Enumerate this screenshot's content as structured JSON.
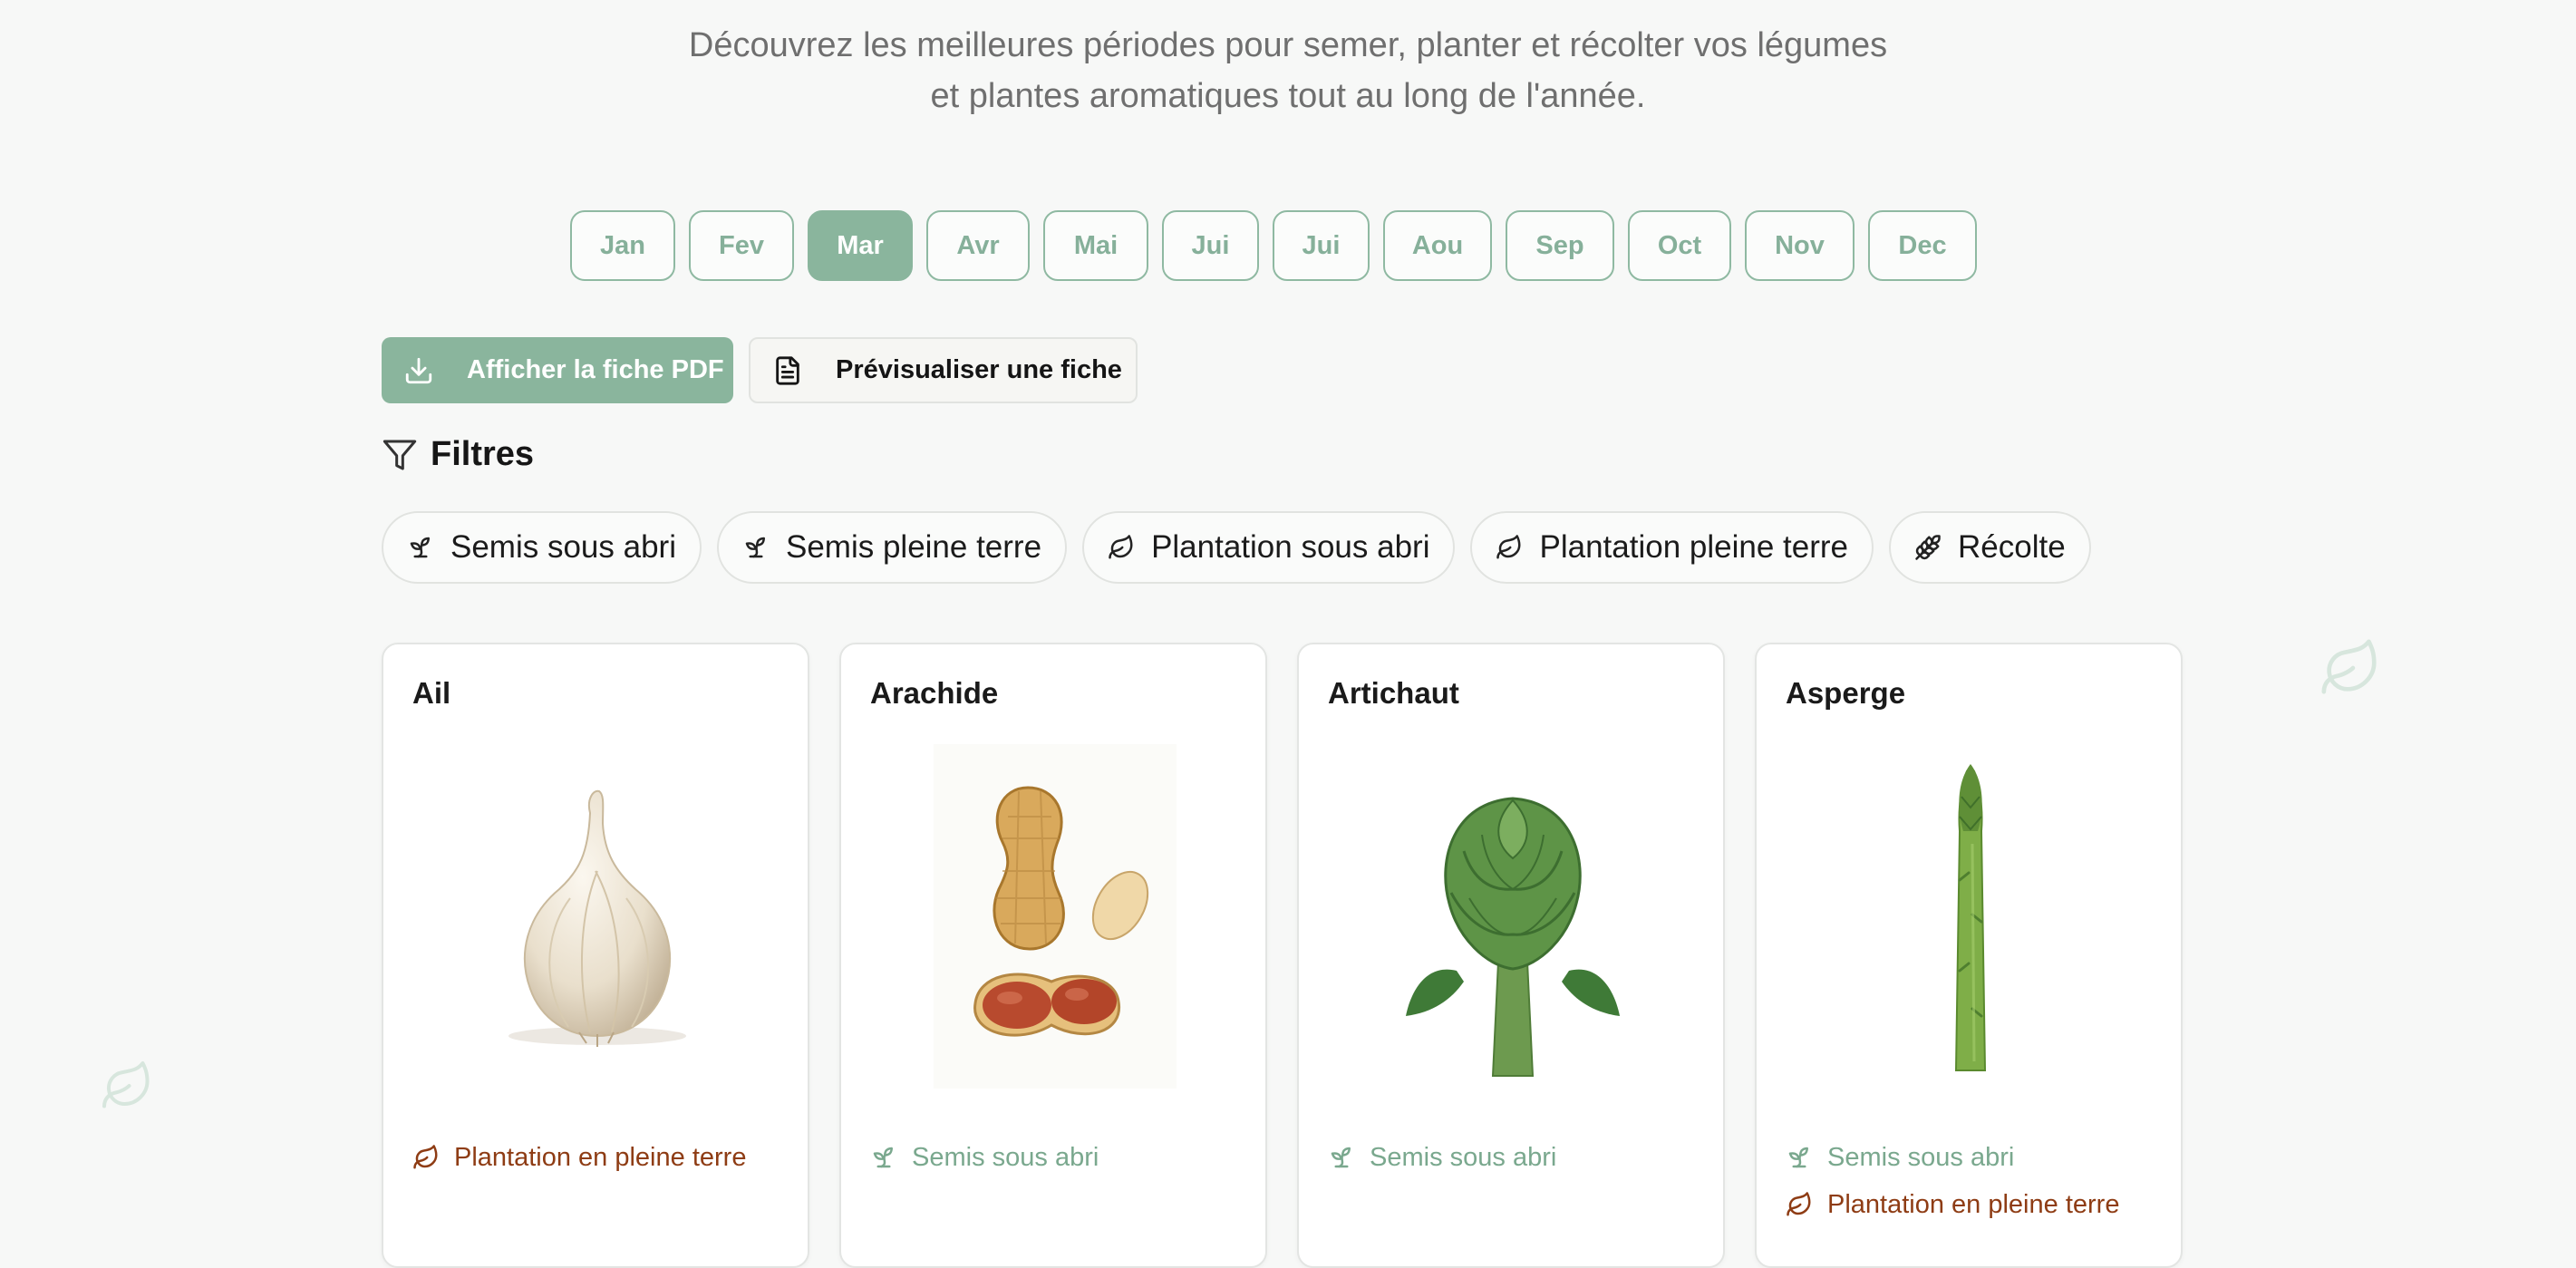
{
  "intro": {
    "line1": "Découvrez les meilleures périodes pour semer, planter et récolter vos légumes",
    "line2": "et plantes aromatiques tout au long de l'année."
  },
  "months": [
    {
      "label": "Jan",
      "active": false
    },
    {
      "label": "Fev",
      "active": false
    },
    {
      "label": "Mar",
      "active": true
    },
    {
      "label": "Avr",
      "active": false
    },
    {
      "label": "Mai",
      "active": false
    },
    {
      "label": "Jui",
      "active": false
    },
    {
      "label": "Jui",
      "active": false
    },
    {
      "label": "Aou",
      "active": false
    },
    {
      "label": "Sep",
      "active": false
    },
    {
      "label": "Oct",
      "active": false
    },
    {
      "label": "Nov",
      "active": false
    },
    {
      "label": "Dec",
      "active": false
    }
  ],
  "actions": {
    "pdf_label": "Afficher la fiche PDF",
    "preview_label": "Prévisualiser une fiche"
  },
  "filters": {
    "title": "Filtres",
    "chips": [
      {
        "label": "Semis sous abri",
        "icon": "sprout-icon"
      },
      {
        "label": "Semis pleine terre",
        "icon": "sprout-icon"
      },
      {
        "label": "Plantation sous abri",
        "icon": "leaf-icon"
      },
      {
        "label": "Plantation pleine terre",
        "icon": "leaf-icon"
      },
      {
        "label": "Récolte",
        "icon": "wheat-icon"
      }
    ]
  },
  "cards": [
    {
      "title": "Ail",
      "image": "garlic",
      "tags": [
        {
          "label": "Plantation en pleine terre",
          "kind": "plant"
        }
      ]
    },
    {
      "title": "Arachide",
      "image": "peanut",
      "tags": [
        {
          "label": "Semis sous abri",
          "kind": "sow"
        }
      ]
    },
    {
      "title": "Artichaut",
      "image": "artichoke",
      "tags": [
        {
          "label": "Semis sous abri",
          "kind": "sow"
        }
      ]
    },
    {
      "title": "Asperge",
      "image": "asparagus",
      "tags": [
        {
          "label": "Semis sous abri",
          "kind": "sow"
        },
        {
          "label": "Plantation en pleine terre",
          "kind": "plant"
        }
      ]
    }
  ],
  "colors": {
    "accent": "#8ab59d",
    "sow_text": "#7aa88e",
    "plant_text": "#8e3c14",
    "background": "#f7f8f7"
  }
}
